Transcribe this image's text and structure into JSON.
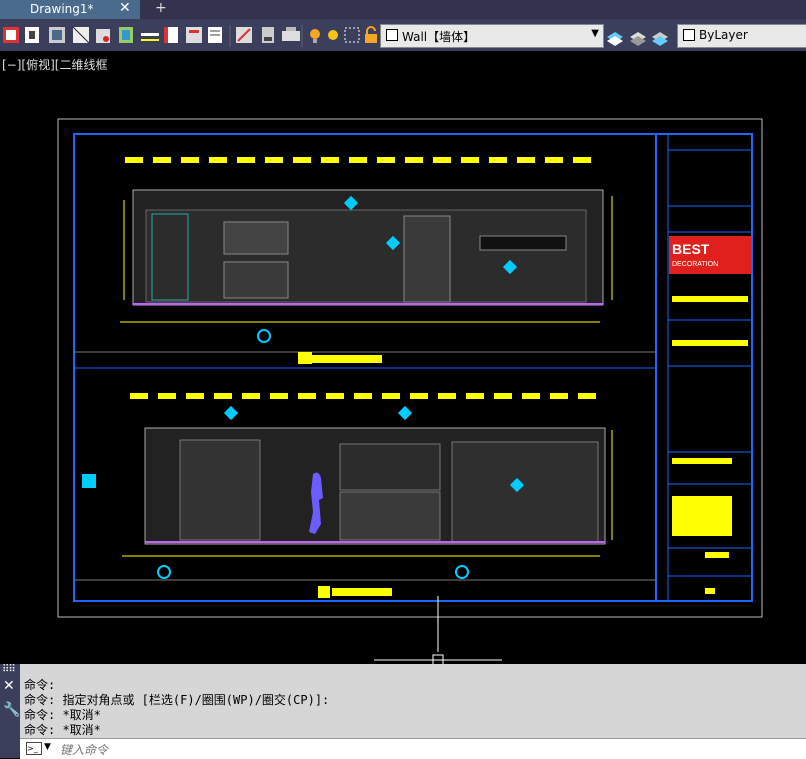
{
  "tabs": {
    "active": "Drawing1*",
    "close": "✕",
    "add": "+"
  },
  "layer_combo": {
    "value": "Wall【墙体】"
  },
  "color_combo": {
    "value": "ByLayer"
  },
  "viewport_label": "[−][俯视][二维线框",
  "command": {
    "lines": [
      "命令:",
      "命令: 指定对角点或 [栏选(F)/圈围(WP)/圈交(CP)]:",
      "命令: *取消*",
      "命令: *取消*"
    ],
    "placeholder": "键入命令"
  },
  "titleblock": {
    "logo_line1": "BEST",
    "logo_line2": "DECORATION"
  },
  "colors": {
    "accent": "#4a6b8c",
    "frame": "#1e64ff",
    "dim": "#ffff00"
  }
}
